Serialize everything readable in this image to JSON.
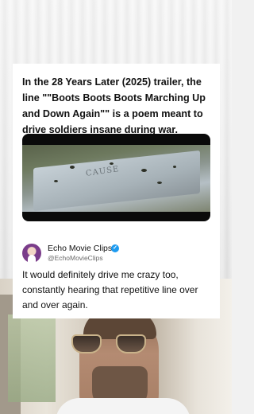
{
  "post": {
    "headline": "In the 28 Years Later (2025) trailer, the line \"\"Boots Boots Boots Marching Up and Down Again\"\" is a poem meant to drive soldiers insane during war.",
    "media": {
      "caption_text": "CAUSE"
    },
    "author": {
      "name": "Echo Movie Clips",
      "handle": "@EchoMovieClips",
      "verified_glyph": "✓"
    },
    "body": "It would definitely drive me crazy too, constantly hearing that repetitive line over and over again."
  },
  "colors": {
    "card_background": "#ffffff",
    "verified_badge": "#1d9bf0",
    "text": "#111111",
    "handle": "#6b6b6b"
  }
}
